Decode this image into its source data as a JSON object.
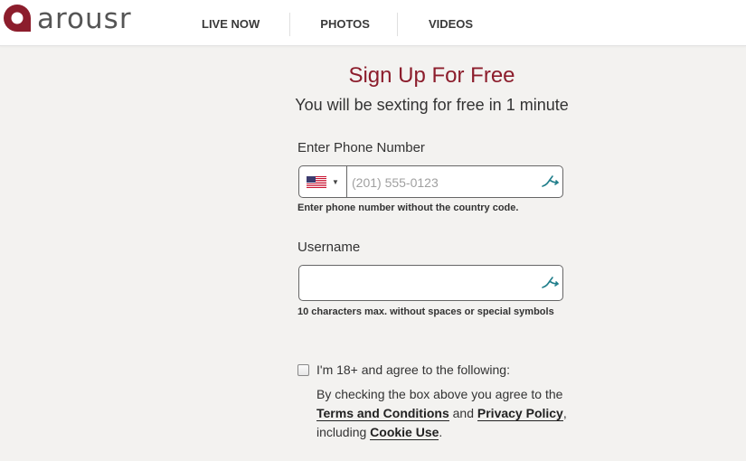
{
  "header": {
    "logo_text": "arousr",
    "nav": [
      {
        "label": "LIVE NOW"
      },
      {
        "label": "PHOTOS"
      },
      {
        "label": "VIDEOS"
      }
    ]
  },
  "signup": {
    "title": "Sign Up For Free",
    "subtitle": "You will be sexting for free in 1 minute",
    "phone": {
      "label": "Enter Phone Number",
      "placeholder": "(201) 555-0123",
      "value": "",
      "country_flag": "us-flag-icon",
      "hint": "Enter phone number without the country code."
    },
    "username": {
      "label": "Username",
      "value": "",
      "hint": "10 characters max. without spaces or special symbols"
    },
    "consent": {
      "checkbox_label": "I'm 18+ and agree to the following:",
      "checked": false,
      "text_before": "By checking the box above you agree to the ",
      "terms_link": "Terms and Conditions",
      "and_text": " and ",
      "privacy_link": "Privacy Policy",
      "including_text": ", including ",
      "cookie_link": "Cookie Use",
      "end_text": "."
    }
  },
  "colors": {
    "brand": "#8c1d2c",
    "field_icon": "#1e7d8a"
  }
}
